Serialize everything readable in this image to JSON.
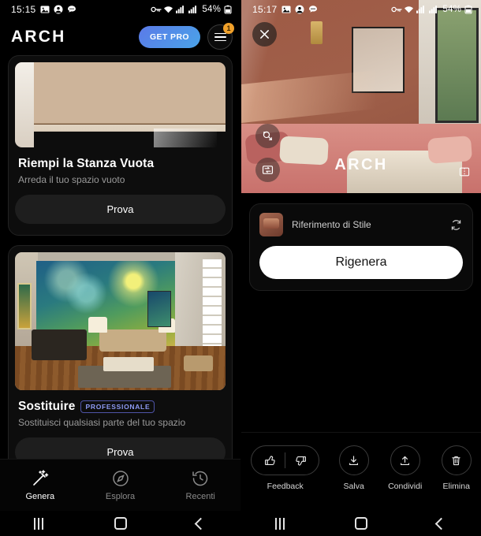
{
  "left": {
    "status": {
      "time": "15:15",
      "battery": "54%",
      "icons": [
        "image-icon",
        "contact-icon",
        "message-icon",
        "vpn-key-icon",
        "wifi-icon",
        "signal-icon",
        "signal-icon-2",
        "battery-icon"
      ]
    },
    "header": {
      "logo": "ARCH",
      "get_pro_label": "GET PRO",
      "menu_badge": "1"
    },
    "cards": [
      {
        "title": "Riempi la Stanza Vuota",
        "badge": "",
        "subtitle": "Arreda il tuo spazio vuoto",
        "button": "Prova",
        "image_name": "empty-room-photo"
      },
      {
        "title": "Sostituire",
        "badge": "PROFESSIONALE",
        "subtitle": "Sostituisci qualsiasi parte del tuo spazio",
        "button": "Prova",
        "image_name": "starry-night-mural-room-photo"
      }
    ],
    "bottom_nav": [
      {
        "label": "Genera",
        "icon": "magic-wand-icon",
        "active": true
      },
      {
        "label": "Esplora",
        "icon": "compass-icon",
        "active": false
      },
      {
        "label": "Recenti",
        "icon": "history-icon",
        "active": false
      }
    ]
  },
  "right": {
    "status": {
      "time": "15:17",
      "battery": "54%"
    },
    "hero": {
      "watermark": "ARCH",
      "close_icon": "close-icon",
      "zoom_icon": "zoom-expand-icon",
      "compare_icon": "compare-swap-icon",
      "corner_icon": "before-after-icon",
      "image_name": "terracotta-bedroom-render"
    },
    "panel": {
      "reference_label": "Riferimento di Stile",
      "refresh_icon": "refresh-icon",
      "thumbnail_name": "style-reference-thumbnail",
      "regenerate_label": "Rigenera"
    },
    "actions": [
      {
        "label": "Feedback",
        "icon": "thumbs-pill-icon"
      },
      {
        "label": "Salva",
        "icon": "download-icon"
      },
      {
        "label": "Condividi",
        "icon": "share-upload-icon"
      },
      {
        "label": "Elimina",
        "icon": "trash-icon"
      }
    ]
  },
  "colors": {
    "accent_blue": "#4aa3e8",
    "badge_orange": "#f0a02a",
    "pro_purple": "#8e9bf5",
    "background": "#000000"
  }
}
